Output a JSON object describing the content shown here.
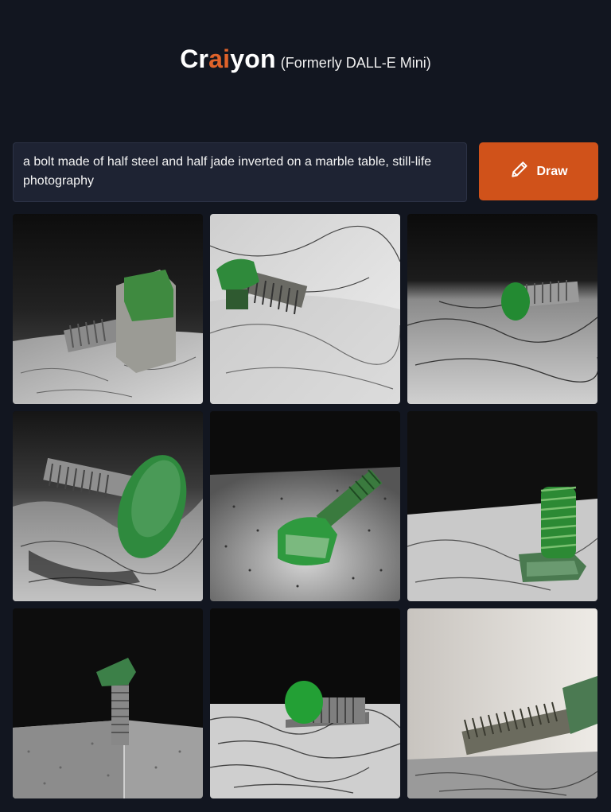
{
  "header": {
    "brand_prefix": "Cr",
    "brand_accent": "ai",
    "brand_suffix": "yon",
    "subtitle": "(Formerly DALL-E Mini)"
  },
  "prompt": {
    "value": "a bolt made of half steel and half jade inverted on a marble table, still-life photography"
  },
  "draw_button": {
    "label": "Draw",
    "icon": "pencil-icon"
  },
  "colors": {
    "background": "#121620",
    "accent": "#e0632a",
    "button": "#d0521a",
    "input_bg": "#1e2333"
  },
  "results": [
    {
      "id": 1,
      "subject": "steel bolt with jade head on marble"
    },
    {
      "id": 2,
      "subject": "jade-capped bolt lying on marble"
    },
    {
      "id": 3,
      "subject": "jade head bolt on dark marble"
    },
    {
      "id": 4,
      "subject": "round jade head bolt tilted"
    },
    {
      "id": 5,
      "subject": "jade bolt on granite spotlit"
    },
    {
      "id": 6,
      "subject": "upright green threaded bolt"
    },
    {
      "id": 7,
      "subject": "vertical bolt with jade cap"
    },
    {
      "id": 8,
      "subject": "bolt lying on speckled granite"
    },
    {
      "id": 9,
      "subject": "close-up of bolt thread"
    }
  ]
}
